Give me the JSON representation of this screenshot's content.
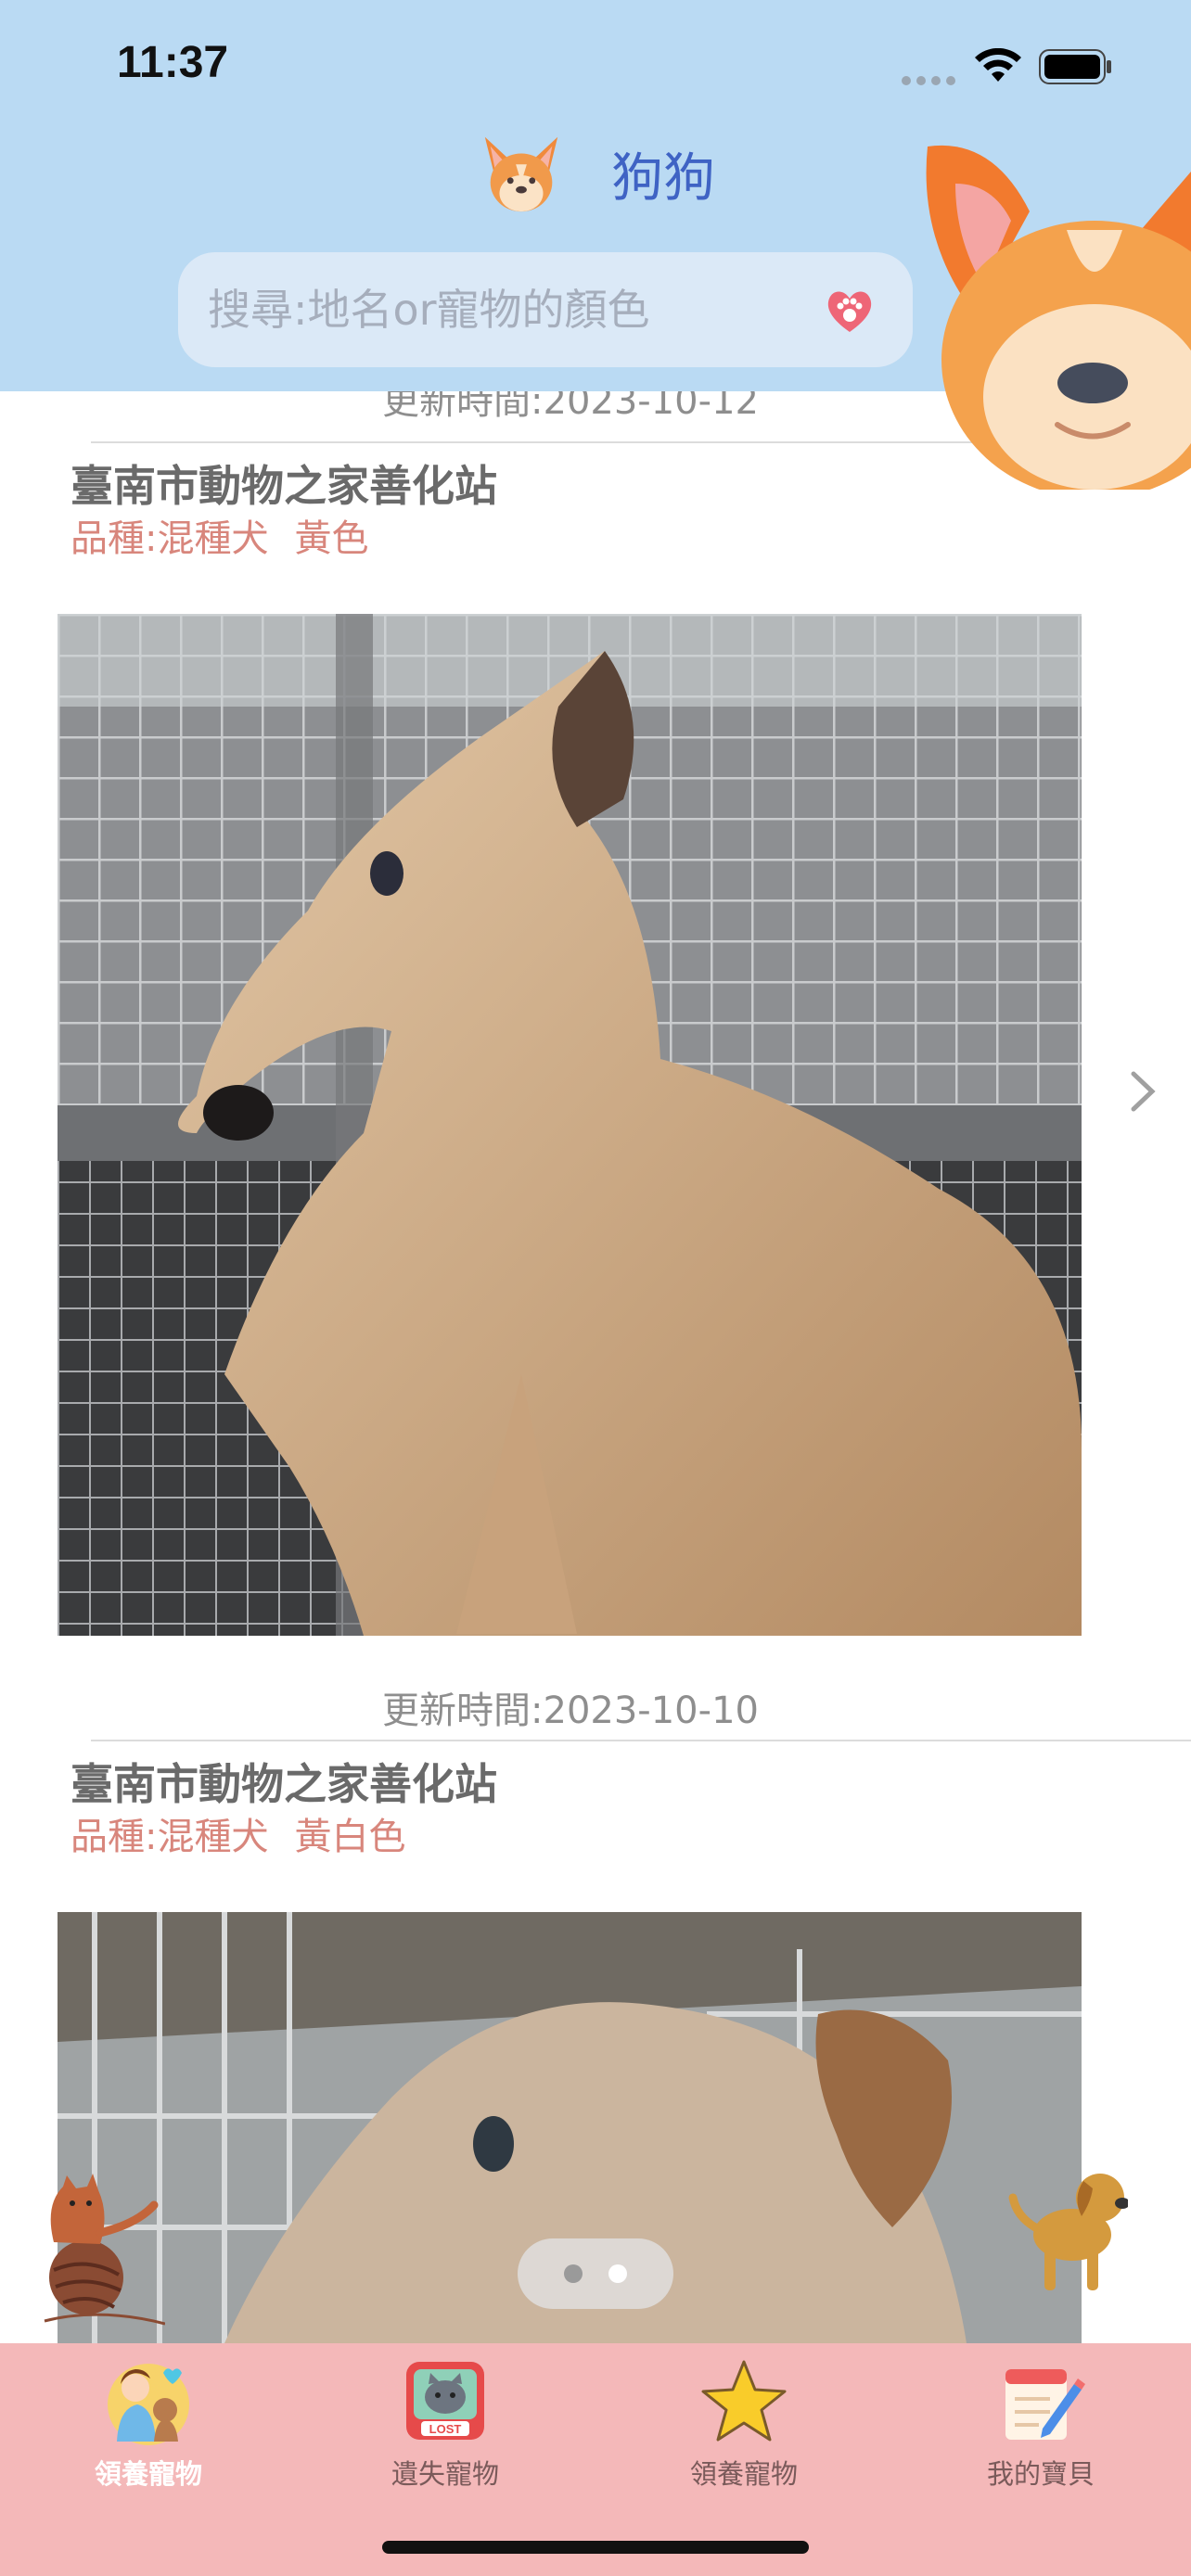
{
  "status": {
    "time": "11:37"
  },
  "header": {
    "title": "狗狗",
    "search_placeholder": "搜尋:地名or寵物的顏色"
  },
  "cards": [
    {
      "updated": "更新時間:2023-10-12",
      "shelter": "臺南市動物之家善化站",
      "breed": "品種:混種犬",
      "color": "黃色"
    },
    {
      "updated": "更新時間:2023-10-10",
      "shelter": "臺南市動物之家善化站",
      "breed": "品種:混種犬",
      "color": "黃白色"
    }
  ],
  "pager": {
    "total": 2,
    "current": 2
  },
  "tabs": [
    {
      "label": "領養寵物",
      "icon": "family-pets-icon",
      "selected": true
    },
    {
      "label": "遺失寵物",
      "icon": "lost-cat-icon",
      "selected": false
    },
    {
      "label": "領養寵物",
      "icon": "star-icon",
      "selected": false
    },
    {
      "label": "我的寶貝",
      "icon": "notepad-icon",
      "selected": false
    }
  ],
  "colors": {
    "header_bg": "#badaf3",
    "title": "#3f63c4",
    "breed_text": "#d8867c",
    "tabbar_bg": "#f4b8b9"
  }
}
